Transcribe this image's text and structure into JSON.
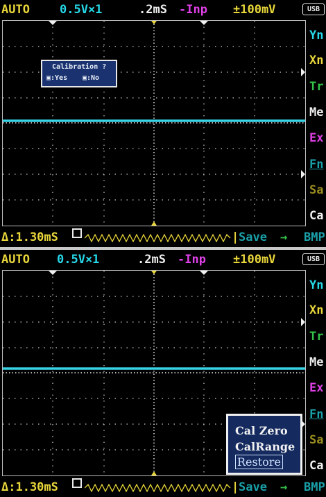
{
  "colors": {
    "yellow": "#e8d63a",
    "cyan": "#26d8e8",
    "magenta": "#e040e8",
    "white": "#f0f0f0",
    "green": "#34c24a",
    "teal": "#1aa0a8",
    "olive": "#9a8c1e",
    "trace": "#39d3e6"
  },
  "screen1": {
    "status": {
      "mode": "AUTO",
      "vdiv": "0.5V×1",
      "tdiv": ".2mS",
      "coupling": "-Inp",
      "trigger": "±100mV",
      "usb": "USB"
    },
    "menu": [
      "Yn",
      "Xn",
      "Tr",
      "Me",
      "Ex",
      "Fn",
      "Sa",
      "Ca"
    ],
    "bottom": {
      "delta": "Δ:1.30mS",
      "save": "Save",
      "arrow": "→",
      "bmp": "BMP"
    },
    "dialog": {
      "title": "Calibration ?",
      "yes": "▣:Yes",
      "no": "▣:No"
    }
  },
  "screen2": {
    "status": {
      "mode": "AUTO",
      "vdiv": "0.5V×1",
      "tdiv": ".2mS",
      "coupling": "-Inp",
      "trigger": "±100mV",
      "usb": "USB"
    },
    "menu": [
      "Yn",
      "Xn",
      "Tr",
      "Me",
      "Ex",
      "Fn",
      "Sa",
      "Ca"
    ],
    "bottom": {
      "delta": "Δ:1.30mS",
      "save": "Save",
      "arrow": "→",
      "bmp": "BMP"
    },
    "calmenu": {
      "item1": "Cal Zero",
      "item2": "CalRange",
      "item3": "Restore"
    }
  }
}
